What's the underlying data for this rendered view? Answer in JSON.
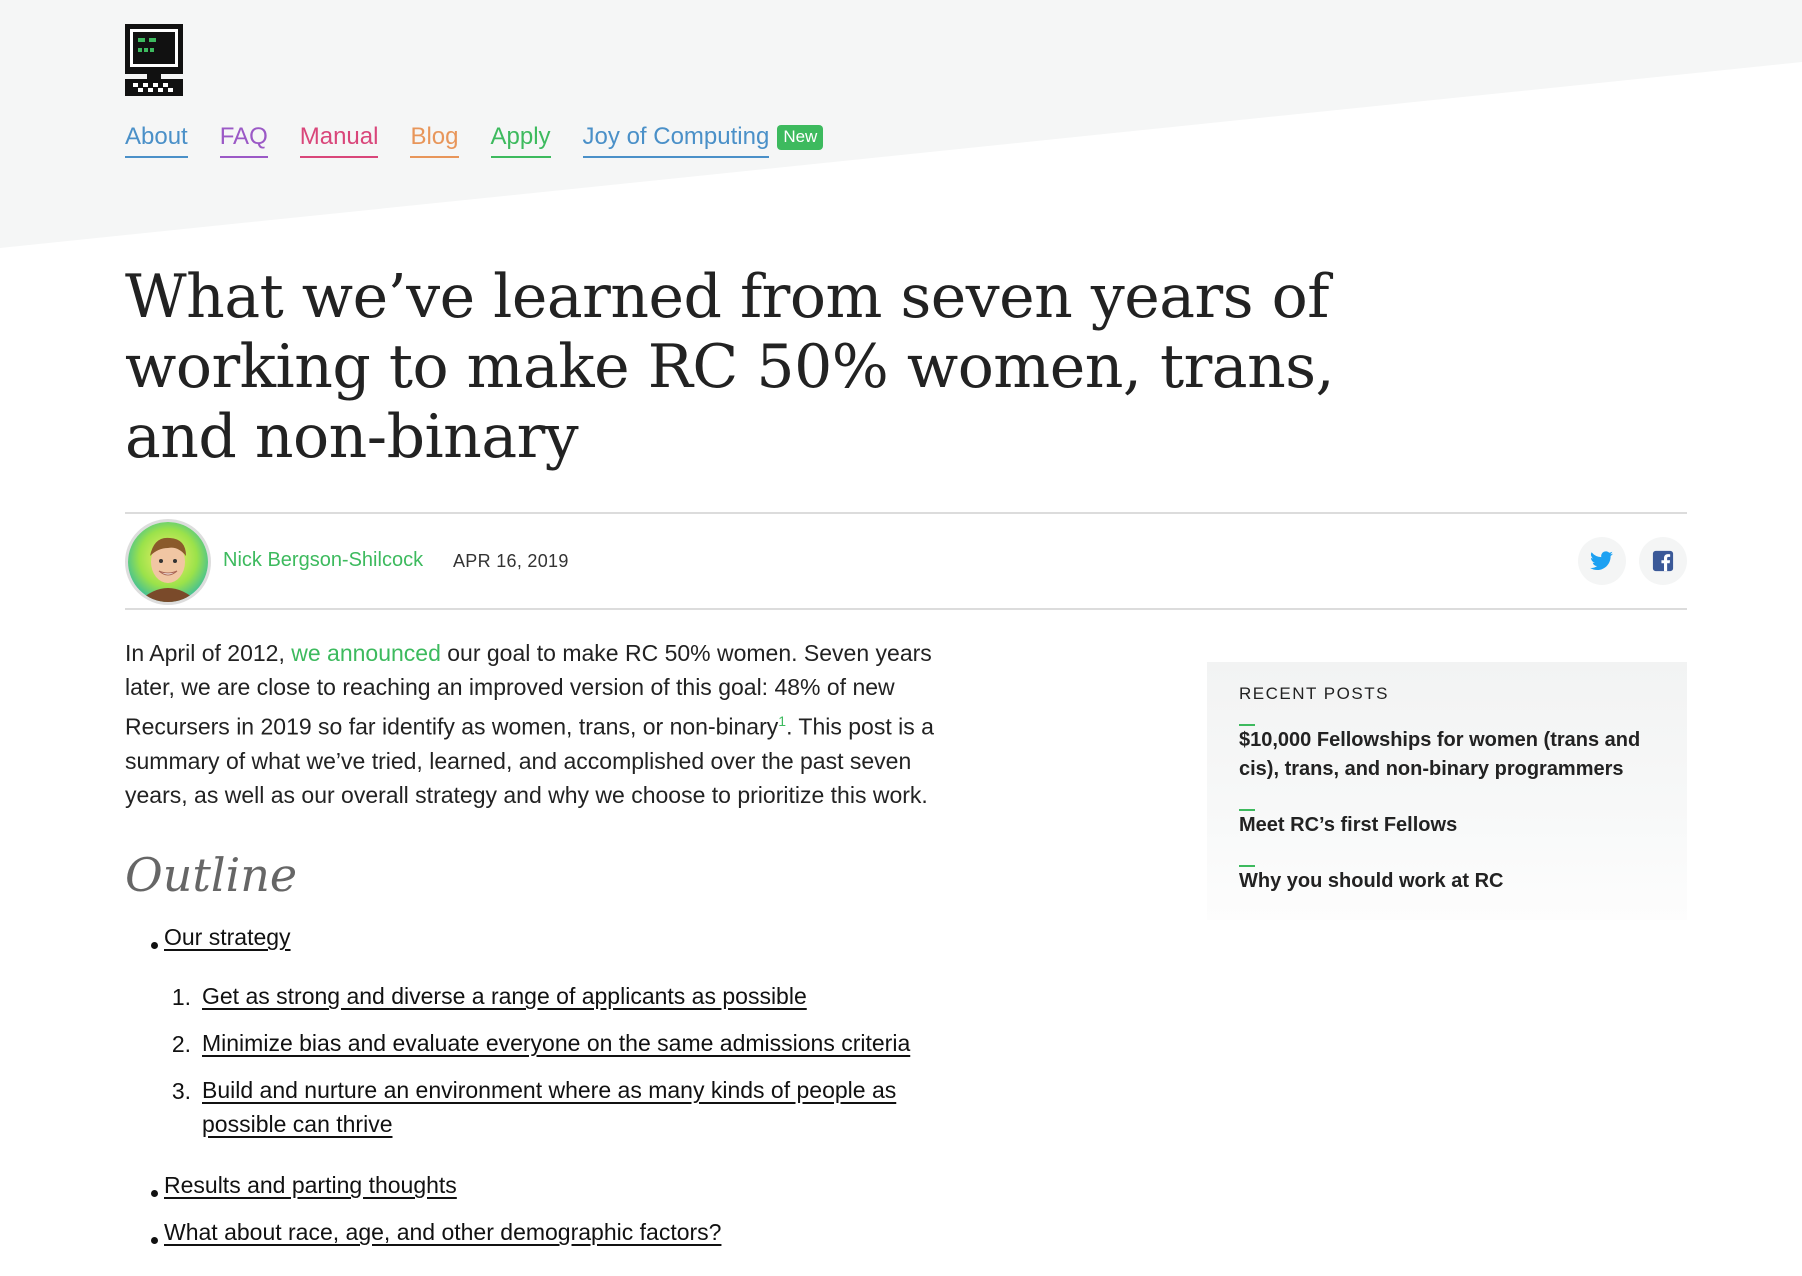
{
  "nav": {
    "items": [
      {
        "label": "About",
        "color": "#4a90c8"
      },
      {
        "label": "FAQ",
        "color": "#9b59c6"
      },
      {
        "label": "Manual",
        "color": "#d9467a"
      },
      {
        "label": "Blog",
        "color": "#e8965a"
      },
      {
        "label": "Apply",
        "color": "#3dba5e"
      },
      {
        "label": "Joy of Computing",
        "color": "#4a90c8"
      }
    ],
    "badge": "New"
  },
  "post": {
    "title": "What we’ve learned from seven years of working to make RC 50% women, trans, and non-binary",
    "author": "Nick Bergson-Shilcock",
    "date": "APR 16, 2019",
    "intro": {
      "p1": "In April of 2012, ",
      "link": "we announced",
      "p2": " our goal to make RC 50% women. Seven years later, we are close to reaching an improved version of this goal: 48% of new Recursers in 2019 so far identify as women, trans, or non-binary",
      "footnote": "1",
      "p3": ". This post is a summary of what we’ve tried, learned, and accomplished over the past seven years, as well as our overall strategy and why we choose to prioritize this work."
    }
  },
  "outline": {
    "heading": "Outline",
    "items": [
      "Our strategy",
      "Results and parting thoughts",
      "What about race, age, and other demographic factors?"
    ],
    "subitems": [
      {
        "num": "1.",
        "label": "Get as strong and diverse a range of applicants as possible"
      },
      {
        "num": "2.",
        "label": "Minimize bias and evaluate everyone on the same admissions criteria"
      },
      {
        "num": "3.",
        "label": "Build and nurture an environment where as many kinds of people as possible can thrive"
      }
    ]
  },
  "sidebar": {
    "heading": "RECENT POSTS",
    "posts": [
      "$10,000 Fellowships for women (trans and cis), trans, and non-binary programmers",
      "Meet RC’s first Fellows",
      "Why you should work at RC"
    ]
  },
  "share": {
    "icons": [
      "twitter-icon",
      "facebook-icon"
    ]
  },
  "colors": {
    "accent": "#3dba5e",
    "twitter": "#1da1f2",
    "facebook": "#3b5998"
  }
}
